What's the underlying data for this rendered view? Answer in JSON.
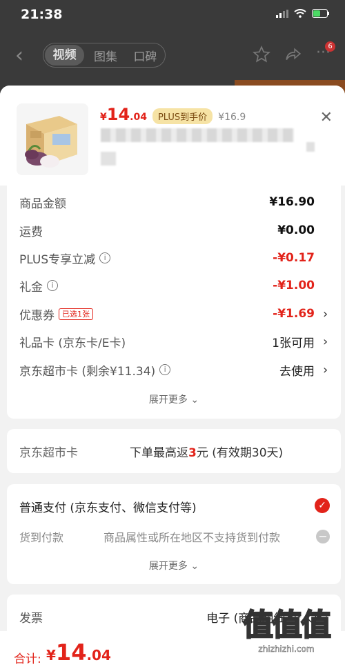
{
  "status": {
    "time": "21:38"
  },
  "nav": {
    "tabs": [
      "视频",
      "图集",
      "口碑"
    ],
    "badge": "6"
  },
  "product": {
    "price_symbol": "¥",
    "price_int": "14",
    "price_dec": ".04",
    "plus_tag": "PLUS到手价",
    "orig_price": "¥16.9"
  },
  "fees": {
    "rows": [
      {
        "label": "商品金额",
        "value": "¥16.90"
      },
      {
        "label": "运费",
        "value": "¥0.00"
      },
      {
        "label": "PLUS专享立减",
        "value": "-¥0.17"
      },
      {
        "label": "礼金",
        "value": "-¥1.00"
      },
      {
        "label": "优惠券",
        "tag": "已选1张",
        "value": "-¥1.69"
      },
      {
        "label": "礼品卡 (京东卡/E卡)",
        "value": "1张可用"
      },
      {
        "label": "京东超市卡 (剩余¥11.34)",
        "value": "去使用"
      }
    ],
    "expand": "展开更多"
  },
  "supermarket": {
    "label": "京东超市卡",
    "prefix": "下单最高返",
    "amount": "3",
    "suffix": "元 (有效期30天)"
  },
  "payment": {
    "option1": "普通支付 (京东支付、微信支付等)",
    "option2": "货到付款",
    "option2_note": "商品属性或所在地区不支持货到付款",
    "expand": "展开更多"
  },
  "invoice": {
    "label": "发票",
    "value": "电子 (商品明细-个人)"
  },
  "total": {
    "label": "合计:",
    "symbol": "¥",
    "int": "14",
    "dec": ".04"
  },
  "watermark": {
    "logo": "值值值",
    "url": "zhizhizhi.com"
  },
  "colors": {
    "accent": "#e2231a",
    "plus_bg": "#f6e3a5"
  }
}
